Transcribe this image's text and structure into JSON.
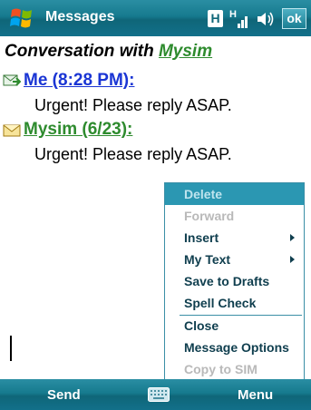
{
  "titlebar": {
    "title": "Messages",
    "h_label": "H",
    "signal_label": "H",
    "ok_label": "ok"
  },
  "conversation": {
    "prefix": "Conversation with ",
    "contact": "Mysim"
  },
  "messages": [
    {
      "sender": "Me (8:28 PM):",
      "text": "Urgent! Please reply ASAP.",
      "icon": "sent-message-icon"
    },
    {
      "sender": "Mysim (6/23):",
      "text": "Urgent! Please reply ASAP.",
      "icon": "received-message-icon"
    }
  ],
  "menu": {
    "items": [
      {
        "label": "Delete",
        "state": "highlighted"
      },
      {
        "label": "Forward",
        "state": "disabled"
      },
      {
        "label": "Insert",
        "state": "enabled",
        "submenu": true
      },
      {
        "label": "My Text",
        "state": "enabled",
        "submenu": true
      },
      {
        "label": "Save to Drafts",
        "state": "enabled"
      },
      {
        "label": "Spell Check",
        "state": "enabled"
      },
      {
        "label": "Close",
        "state": "enabled"
      },
      {
        "label": "Message Options",
        "state": "enabled"
      },
      {
        "label": "Copy to SIM",
        "state": "disabled"
      }
    ]
  },
  "softkeys": {
    "left": "Send",
    "right": "Menu",
    "center_icon": "keyboard-icon"
  },
  "colors": {
    "bar": "#167a8e",
    "me_link": "#1a35d4",
    "contact_link": "#2e8b2e",
    "menu_highlight": "#2b97b2",
    "menu_text": "#0f3e4e",
    "menu_disabled": "#b9b9b9"
  }
}
